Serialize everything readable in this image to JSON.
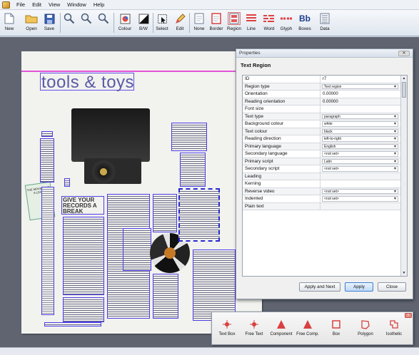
{
  "menu": [
    "File",
    "Edit",
    "View",
    "Window",
    "Help"
  ],
  "toolbar": {
    "buttons": [
      {
        "label": "New",
        "icon": "new-document-icon"
      },
      {
        "label": "Open",
        "icon": "open-folder-icon"
      },
      {
        "label": "Save",
        "icon": "save-disk-icon"
      },
      {
        "label": "",
        "icon": "zoom-in-icon"
      },
      {
        "label": "",
        "icon": "zoom-out-icon"
      },
      {
        "label": "",
        "icon": "zoom-fit-icon"
      },
      {
        "label": "Colour",
        "icon": "colour-icon"
      },
      {
        "label": "B/W",
        "icon": "black-white-icon"
      },
      {
        "label": "Select",
        "icon": "select-icon"
      },
      {
        "label": "Edit",
        "icon": "edit-pencil-icon"
      },
      {
        "label": "None",
        "icon": "none-icon"
      },
      {
        "label": "Border",
        "icon": "border-icon"
      },
      {
        "label": "Region",
        "icon": "region-icon"
      },
      {
        "label": "Line",
        "icon": "line-icon"
      },
      {
        "label": "Word",
        "icon": "word-icon"
      },
      {
        "label": "Glyph",
        "icon": "glyph-icon"
      },
      {
        "label": "Boxes",
        "icon": "boxes-icon"
      },
      {
        "label": "Data",
        "icon": "data-icon"
      }
    ]
  },
  "page": {
    "title": "tools & toys",
    "headline": "GIVE YOUR RECORDS A BREAK",
    "sticker_text": "THE MOVE TAKE A LOOK"
  },
  "properties": {
    "window_title": "Properties",
    "heading": "Text Region",
    "rows": [
      {
        "key": "ID",
        "value": "r7",
        "type": "text"
      },
      {
        "key": "Region type",
        "value": "Text region",
        "type": "dropdown"
      },
      {
        "key": "Orientation",
        "value": "0.00000",
        "type": "text"
      },
      {
        "key": "Reading orientation",
        "value": "0.00000",
        "type": "text"
      },
      {
        "key": "Font size",
        "value": "",
        "type": "text"
      },
      {
        "key": "Text type",
        "value": "paragraph",
        "type": "dropdown"
      },
      {
        "key": "Background colour",
        "value": "white",
        "type": "dropdown"
      },
      {
        "key": "Text colour",
        "value": "black",
        "type": "dropdown"
      },
      {
        "key": "Reading direction",
        "value": "left-to-right",
        "type": "dropdown"
      },
      {
        "key": "Primary language",
        "value": "English",
        "type": "dropdown"
      },
      {
        "key": "Secondary language",
        "value": "<not set>",
        "type": "dropdown"
      },
      {
        "key": "Primary script",
        "value": "Latin",
        "type": "dropdown"
      },
      {
        "key": "Secondary script",
        "value": "<not set>",
        "type": "dropdown"
      },
      {
        "key": "Leading",
        "value": "",
        "type": "text"
      },
      {
        "key": "Kerning",
        "value": "",
        "type": "text"
      },
      {
        "key": "Reverse video",
        "value": "<not set>",
        "type": "dropdown"
      },
      {
        "key": "Indented",
        "value": "<not set>",
        "type": "dropdown"
      },
      {
        "key": "Plain text",
        "value": "",
        "type": "text"
      }
    ],
    "buttons": {
      "apply_next": "Apply and Next",
      "apply": "Apply",
      "close": "Close"
    }
  },
  "shape_toolbar": {
    "buttons": [
      {
        "label": "Text Box",
        "icon": "text-box-icon"
      },
      {
        "label": "Free Text",
        "icon": "free-text-icon"
      },
      {
        "label": "Component",
        "icon": "component-icon"
      },
      {
        "label": "Free Comp.",
        "icon": "free-component-icon"
      },
      {
        "label": "Box",
        "icon": "box-icon"
      },
      {
        "label": "Polygon",
        "icon": "polygon-icon"
      },
      {
        "label": "Isothetic",
        "icon": "isothetic-icon"
      }
    ]
  },
  "colors": {
    "region_border": "#4b3de6",
    "title_line": "#e154d7",
    "accent_red": "#d94040"
  }
}
